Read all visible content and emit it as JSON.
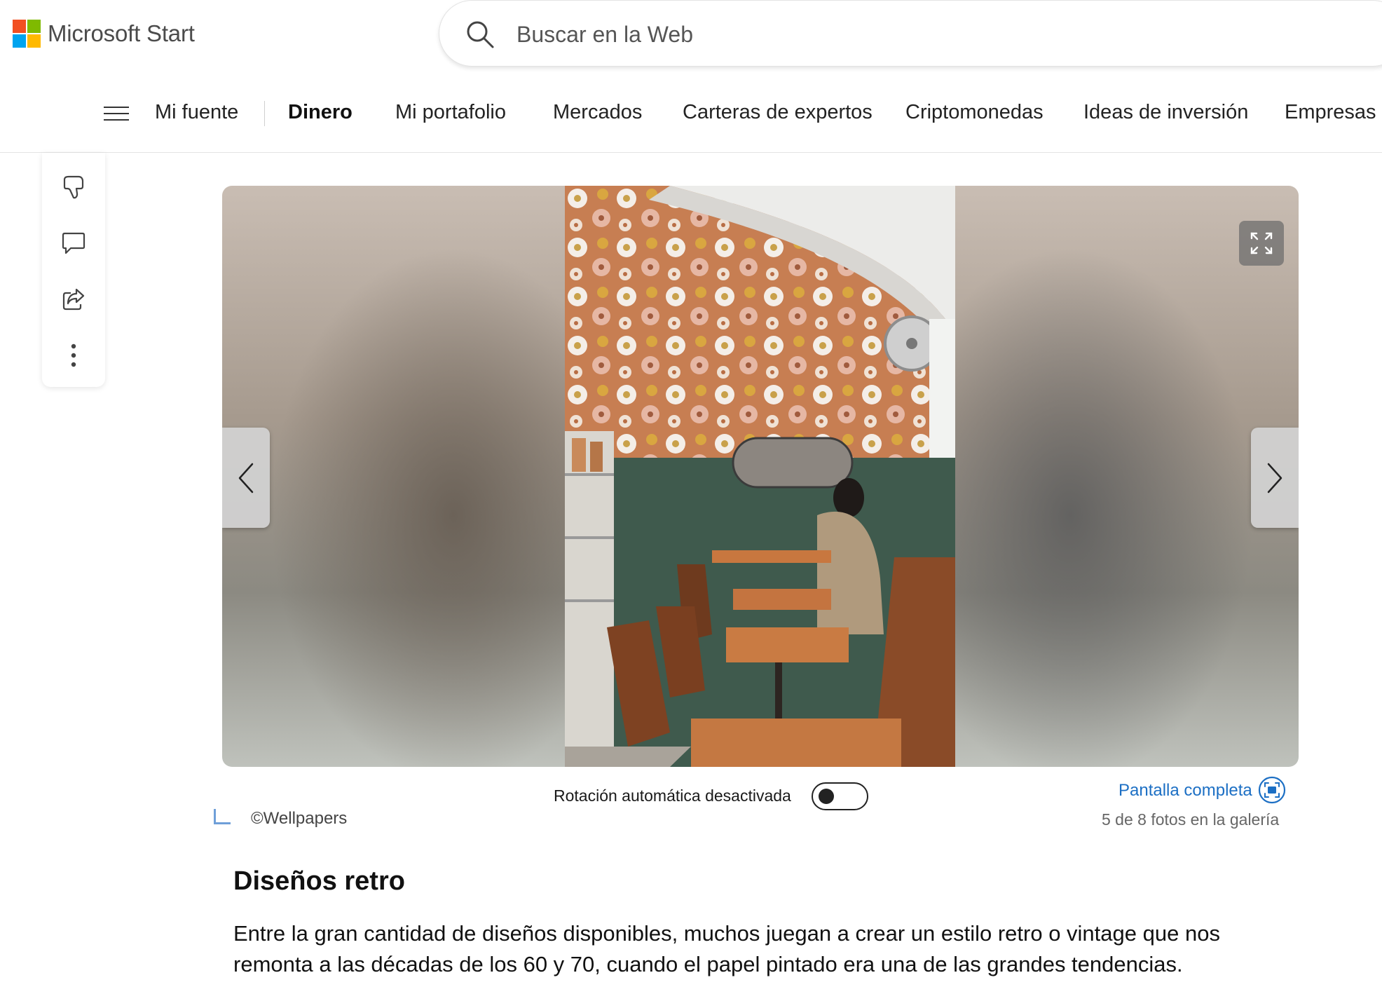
{
  "brand": {
    "name": "Microsoft Start",
    "logo_colors": [
      "#f25022",
      "#7fba00",
      "#00a4ef",
      "#ffb900"
    ]
  },
  "search": {
    "placeholder": "Buscar en la Web",
    "value": ""
  },
  "nav": {
    "items": [
      {
        "label": "Mi fuente",
        "active": false
      },
      {
        "label": "Dinero",
        "active": true
      },
      {
        "label": "Mi portafolio",
        "active": false
      },
      {
        "label": "Mercados",
        "active": false
      },
      {
        "label": "Carteras de expertos",
        "active": false
      },
      {
        "label": "Criptomonedas",
        "active": false
      },
      {
        "label": "Ideas de inversión",
        "active": false
      },
      {
        "label": "Empresas",
        "active": false
      }
    ]
  },
  "rail": {
    "icons": [
      "dislike-icon",
      "comment-icon",
      "share-icon",
      "more-options-icon"
    ]
  },
  "gallery": {
    "attribution": "©Wellpapers",
    "autorotate_label": "Rotación automática desactivada",
    "autorotate_on": false,
    "fullscreen_label": "Pantalla completa",
    "count_text": "5 de 8 fotos en la galería"
  },
  "article": {
    "heading": "Diseños retro",
    "body": "Entre la gran cantidad de diseños disponibles, muchos juegan a crear un estilo retro o vintage que nos remonta a las décadas de los 60 y 70, cuando el papel pintado era una de las grandes tendencias."
  },
  "colors": {
    "link": "#1c6fc4",
    "attribution_mark": "#6f9fd8"
  }
}
